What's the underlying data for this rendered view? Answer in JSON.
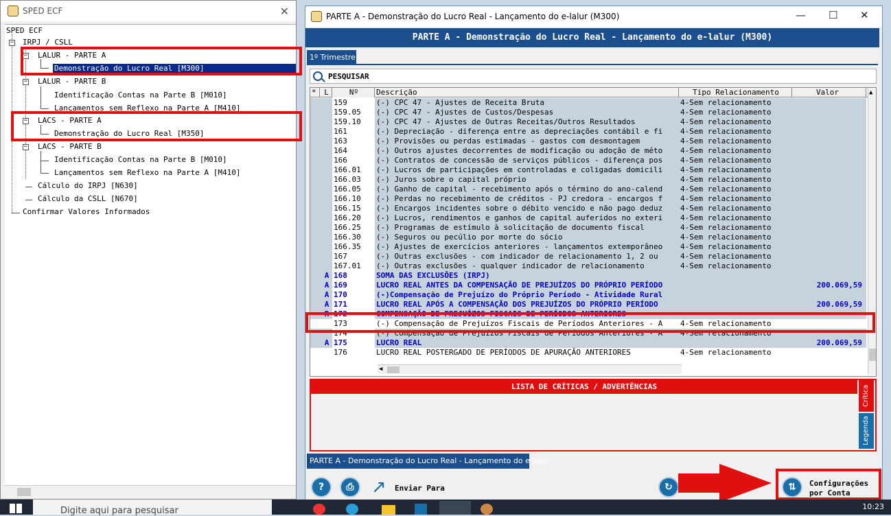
{
  "left_window": {
    "title": "SPED ECF",
    "tree": {
      "root": "SPED ECF",
      "irpj": "IRPJ / CSLL",
      "lalur_a": "LALUR - PARTE A",
      "lalur_a_item": "Demonstração do Lucro Real [M300]",
      "lalur_b": "LALUR - PARTE B",
      "lalur_b_item1": "Identificação Contas na Parte B [M010]",
      "lalur_b_item2": "Lançamentos sem Reflexo na Parte A [M410]",
      "lacs_a": "LACS - PARTE A",
      "lacs_a_item": "Demonstração do Lucro Real [M350]",
      "lacs_b": "LACS - PARTE B",
      "lacs_b_item1": "Identificação Contas na Parte B [M010]",
      "lacs_b_item2": "Lançamentos sem Reflexo na Parte A [M410]",
      "calc_irpj": "Cálculo do IRPJ [N630]",
      "calc_csll": "Cálculo da CSLL [N670]",
      "confirmar": "Confirmar Valores Informados"
    }
  },
  "right_window": {
    "title": "PARTE A - Demonstração do Lucro Real - Lançamento do e-lalur (M300)",
    "banner": "PARTE A - Demonstração do Lucro Real - Lançamento do e-lalur (M300)",
    "tab": "1º Trimestre",
    "search_label": "PESQUISAR",
    "columns": {
      "star": "*",
      "l": "L",
      "num": "Nº",
      "desc": "Descrição",
      "tipo": "Tipo Relacionamento",
      "valor": "Valor"
    },
    "rows": [
      {
        "l": "",
        "num": "159",
        "desc": "(-) CPC 47 - Ajustes de Receita Bruta",
        "tipo": "4-Sem relacionamento",
        "valor": ""
      },
      {
        "l": "",
        "num": "159.05",
        "desc": "(-) CPC 47 - Ajustes de Custos/Despesas",
        "tipo": "4-Sem relacionamento",
        "valor": ""
      },
      {
        "l": "",
        "num": "159.10",
        "desc": "(-) CPC 47 - Ajustes de Outras Receitas/Outros Resultados",
        "tipo": "4-Sem relacionamento",
        "valor": ""
      },
      {
        "l": "",
        "num": "161",
        "desc": "(-) Depreciação - diferença entre as depreciações contábil e fi",
        "tipo": "4-Sem relacionamento",
        "valor": ""
      },
      {
        "l": "",
        "num": "163",
        "desc": "(-) Provisões ou perdas estimadas - gastos com desmontagem",
        "tipo": "4-Sem relacionamento",
        "valor": ""
      },
      {
        "l": "",
        "num": "164",
        "desc": "(-) Outros ajustes decorrentes de modificação ou adoção de méto",
        "tipo": "4-Sem relacionamento",
        "valor": ""
      },
      {
        "l": "",
        "num": "166",
        "desc": "(-) Contratos de concessão de serviços públicos - diferença pos",
        "tipo": "4-Sem relacionamento",
        "valor": ""
      },
      {
        "l": "",
        "num": "166.01",
        "desc": "(-) Lucros de participações em controladas e coligadas domicili",
        "tipo": "4-Sem relacionamento",
        "valor": ""
      },
      {
        "l": "",
        "num": "166.03",
        "desc": "(-) Juros sobre o capital próprio",
        "tipo": "4-Sem relacionamento",
        "valor": ""
      },
      {
        "l": "",
        "num": "166.05",
        "desc": "(-) Ganho de capital - recebimento após o término do ano-calend",
        "tipo": "4-Sem relacionamento",
        "valor": ""
      },
      {
        "l": "",
        "num": "166.10",
        "desc": "(-) Perdas no recebimento de créditos - PJ credora - encargos f",
        "tipo": "4-Sem relacionamento",
        "valor": ""
      },
      {
        "l": "",
        "num": "166.15",
        "desc": "(-) Encargos incidentes sobre o débito vencido e não pago deduz",
        "tipo": "4-Sem relacionamento",
        "valor": ""
      },
      {
        "l": "",
        "num": "166.20",
        "desc": "(-) Lucros, rendimentos e ganhos de capital auferidos no exteri",
        "tipo": "4-Sem relacionamento",
        "valor": ""
      },
      {
        "l": "",
        "num": "166.25",
        "desc": "(-) Programas de estímulo à solicitação de documento fiscal",
        "tipo": "4-Sem relacionamento",
        "valor": ""
      },
      {
        "l": "",
        "num": "166.30",
        "desc": "(-) Seguros ou pecúlio por morte do sócio",
        "tipo": "4-Sem relacionamento",
        "valor": ""
      },
      {
        "l": "",
        "num": "166.35",
        "desc": "(-) Ajustes de exercícios anteriores - lançamentos extemporâneo",
        "tipo": "4-Sem relacionamento",
        "valor": ""
      },
      {
        "l": "",
        "num": "167",
        "desc": "(-) Outras exclusões - com indicador de relacionamento 1, 2 ou",
        "tipo": "4-Sem relacionamento",
        "valor": ""
      },
      {
        "l": "",
        "num": "167.01",
        "desc": "(-) Outras exclusões - qualquer indicador de relacionamento",
        "tipo": "4-Sem relacionamento",
        "valor": ""
      },
      {
        "l": "A",
        "num": "168",
        "desc": "SOMA DAS EXCLUSÕES (IRPJ)",
        "tipo": "",
        "valor": ""
      },
      {
        "l": "A",
        "num": "169",
        "desc": "LUCRO REAL ANTES DA COMPENSAÇÃO DE PREJUÍZOS DO PRÓPRIO PERÍODO",
        "tipo": "",
        "valor": "200.069,59"
      },
      {
        "l": "A",
        "num": "170",
        "desc": "(-)Compensação de Prejuízo do Próprio Período - Atividade Rural",
        "tipo": "",
        "valor": ""
      },
      {
        "l": "A",
        "num": "171",
        "desc": "LUCRO REAL APÓS A COMPENSAÇÃO DOS PREJUÍZOS DO PRÓPRIO PERÍODO",
        "tipo": "",
        "valor": "200.069,59"
      },
      {
        "l": "R",
        "num": "172",
        "desc": "COMPENSAÇÃO DE PREJUÍZOS FISCAIS DE PERÍODOS ANTERIORES",
        "tipo": "",
        "valor": ""
      },
      {
        "l": "",
        "num": "173",
        "desc": "(-) Compensação de Prejuízos Fiscais de Períodos Anteriores - A",
        "tipo": "4-Sem relacionamento",
        "valor": ""
      },
      {
        "l": "",
        "num": "174",
        "desc": "(-) Compensação de Prejuízos Fiscais de Períodos Anteriores - A",
        "tipo": "4-Sem relacionamento",
        "valor": ""
      },
      {
        "l": "A",
        "num": "175",
        "desc": "LUCRO REAL",
        "tipo": "",
        "valor": "200.069,59"
      },
      {
        "l": "",
        "num": "176",
        "desc": "LUCRO REAL POSTERGADO DE PERÍODOS DE APURAÇÃO ANTERIORES",
        "tipo": "4-Sem relacionamento",
        "valor": ""
      }
    ],
    "criticas_title": "LISTA DE CRÍTICAS / ADVERTÊNCIAS",
    "side_critica": "Crítica",
    "side_legenda": "Legenda",
    "bottom_tab": "PARTE A - Demonstração do Lucro Real - Lançamento do e-lalur",
    "btn_enviar": "Enviar Para",
    "btn_config_1": "Configurações",
    "btn_config_2": "por Conta"
  },
  "taskbar": {
    "search_placeholder": "Digite aqui para pesquisar",
    "clock": "10:23"
  }
}
